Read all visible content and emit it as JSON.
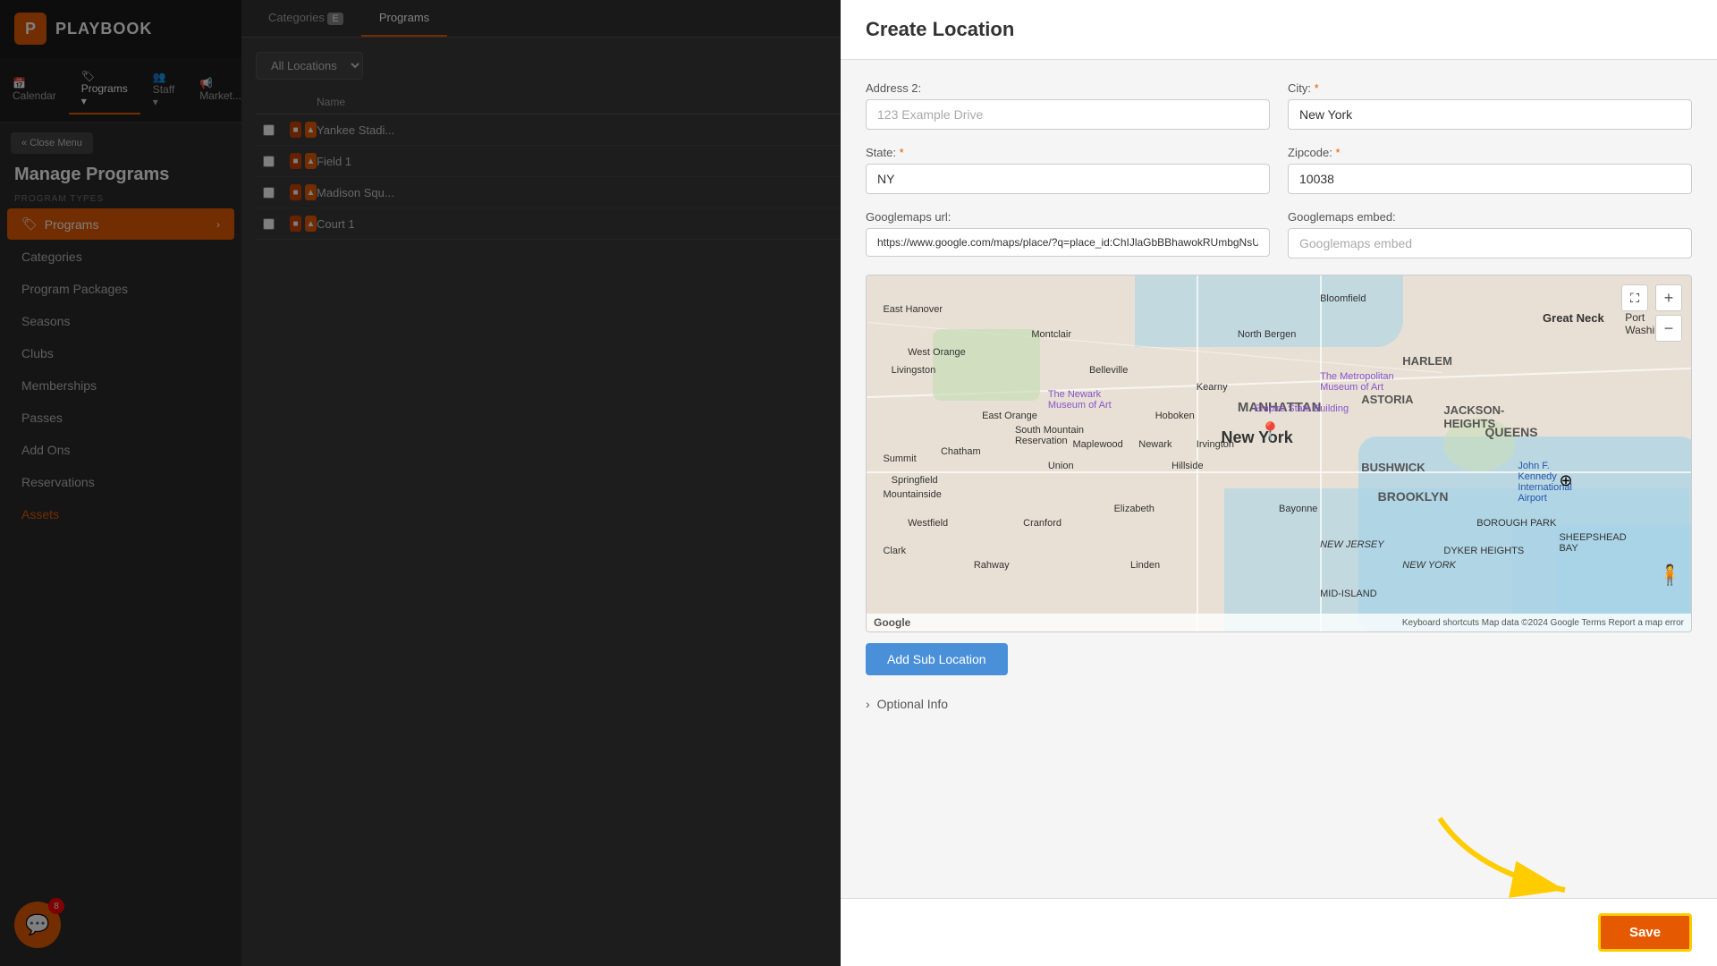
{
  "app": {
    "logo_letter": "P",
    "logo_text": "PLAYBOOK"
  },
  "top_nav": {
    "items": [
      {
        "label": "📅 Calendar",
        "active": false
      },
      {
        "label": "🏷 Programs",
        "active": true,
        "has_dropdown": true
      },
      {
        "label": "👥 Staff",
        "active": false,
        "has_dropdown": true
      },
      {
        "label": "📢 Market...",
        "active": false
      }
    ]
  },
  "close_menu_btn": "« Close Menu",
  "sidebar": {
    "title": "Manage Programs",
    "section_label": "PROGRAM TYPES",
    "items": [
      {
        "label": "Programs",
        "active": true,
        "icon": "🏷"
      },
      {
        "label": "Categories",
        "active": false
      },
      {
        "label": "Program Packages",
        "active": false
      },
      {
        "label": "Seasons",
        "active": false
      },
      {
        "label": "Clubs",
        "active": false
      },
      {
        "label": "Memberships",
        "active": false
      },
      {
        "label": "Passes",
        "active": false
      },
      {
        "label": "Add Ons",
        "active": false
      },
      {
        "label": "Reservations",
        "active": false
      },
      {
        "label": "Assets",
        "active": false,
        "highlight": true
      }
    ]
  },
  "chat": {
    "badge_count": "8"
  },
  "content": {
    "tabs": [
      {
        "label": "Categories",
        "count": "E",
        "active": false
      },
      {
        "label": "Programs",
        "active": true
      }
    ],
    "filter_label": "All Locations",
    "table": {
      "columns": [
        "",
        "",
        "Name"
      ],
      "rows": [
        {
          "name": "Yankee Stadi..."
        },
        {
          "name": "Field 1"
        },
        {
          "name": "Madison Squ..."
        },
        {
          "name": "Court 1"
        }
      ]
    }
  },
  "modal": {
    "title": "Create Location",
    "form": {
      "address2": {
        "label": "Address 2:",
        "placeholder": "123 Example Drive",
        "value": ""
      },
      "city": {
        "label": "City:",
        "required": true,
        "value": "New York"
      },
      "state": {
        "label": "State:",
        "required": true,
        "value": "NY"
      },
      "zipcode": {
        "label": "Zipcode:",
        "required": true,
        "value": "10038"
      },
      "googlemaps_url": {
        "label": "Googlemaps url:",
        "value": "https://www.google.com/maps/place/?q=place_id:ChIJlaGbBBhawokRUmbgNsUmr-s"
      },
      "googlemaps_embed": {
        "label": "Googlemaps embed:",
        "placeholder": "Googlemaps embed",
        "value": ""
      }
    },
    "map": {
      "pin_label": "New York",
      "great_neck_label": "Great Neck",
      "footer_text": "Keyboard shortcuts  Map data ©2024 Google  Terms  Report a map error"
    },
    "add_sub_location_btn": "Add Sub Location",
    "optional_info_label": "Optional Info",
    "save_btn": "Save"
  }
}
